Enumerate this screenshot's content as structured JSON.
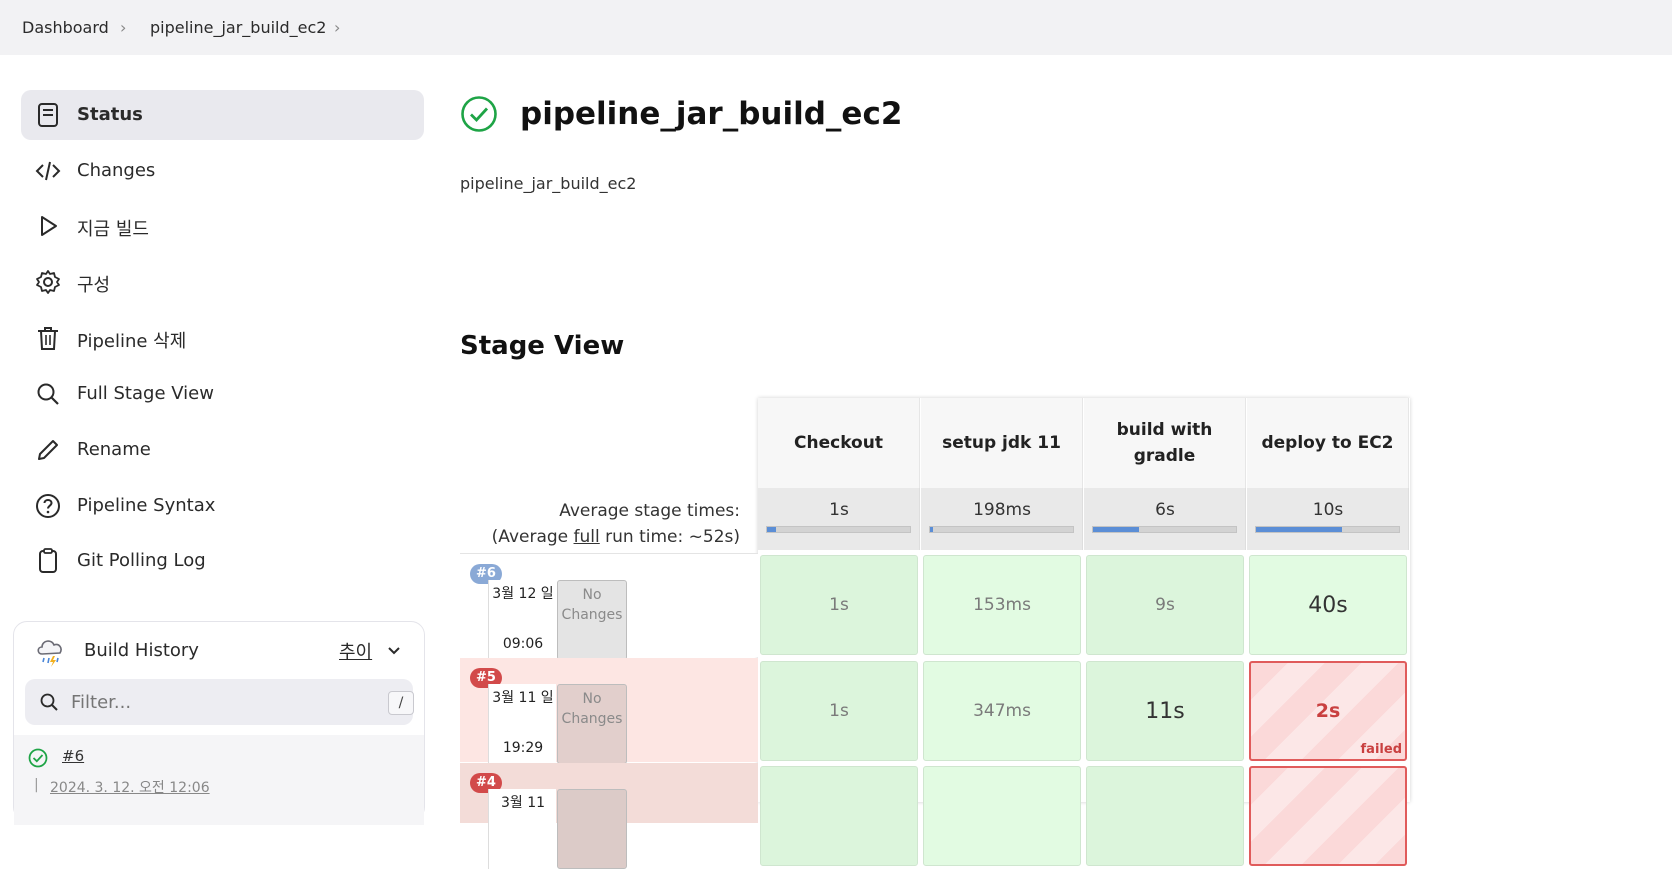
{
  "breadcrumb": {
    "items": [
      "Dashboard",
      "pipeline_jar_build_ec2"
    ]
  },
  "sidebar": {
    "items": [
      {
        "label": "Status",
        "icon": "status-icon"
      },
      {
        "label": "Changes",
        "icon": "code-icon"
      },
      {
        "label": "지금 빌드",
        "icon": "play-icon"
      },
      {
        "label": "구성",
        "icon": "gear-icon"
      },
      {
        "label": "Pipeline 삭제",
        "icon": "trash-icon"
      },
      {
        "label": "Full Stage View",
        "icon": "search-icon"
      },
      {
        "label": "Rename",
        "icon": "pencil-icon"
      },
      {
        "label": "Pipeline Syntax",
        "icon": "help-icon"
      },
      {
        "label": "Git Polling Log",
        "icon": "clipboard-icon"
      }
    ]
  },
  "build_history": {
    "title": "Build History",
    "trend": "추이",
    "filter_placeholder": "Filter...",
    "shortcut": "/",
    "entries": [
      {
        "number": "#6",
        "date": "2024. 3. 12. 오전 12:06",
        "status": "success"
      }
    ]
  },
  "main": {
    "title": "pipeline_jar_build_ec2",
    "description": "pipeline_jar_build_ec2",
    "stage_view_title": "Stage View"
  },
  "stage_view": {
    "stages": [
      "Checkout",
      "setup jdk 11",
      "build with gradle",
      "deploy to EC2"
    ],
    "avg_label_line1": "Average stage times:",
    "avg_label_line2_pre": "(Average ",
    "avg_label_full": "full",
    "avg_label_line2_post": " run time: ~52s)",
    "avg_times": [
      "1s",
      "198ms",
      "6s",
      "10s"
    ],
    "avg_fraction": [
      0.06,
      0.02,
      0.32,
      0.6
    ],
    "no_changes": "No Changes",
    "runs": [
      {
        "badge": "#6",
        "date": "3월 12 일",
        "time": "09:06",
        "status": "success",
        "times": [
          "1s",
          "153ms",
          "9s",
          "40s"
        ]
      },
      {
        "badge": "#5",
        "date": "3월 11 일",
        "time": "19:29",
        "status": "failed",
        "times": [
          "1s",
          "347ms",
          "11s",
          "2s"
        ],
        "failed_label": "failed"
      },
      {
        "badge": "#4",
        "date": "3월 11",
        "time": "",
        "status": "failed",
        "times": [
          "",
          "",
          "",
          ""
        ]
      }
    ]
  },
  "colors": {
    "success": "#1ea446",
    "failed": "#d24a4a",
    "badge_ok": "#8aa9d6",
    "bar": "#5b8ed6"
  }
}
